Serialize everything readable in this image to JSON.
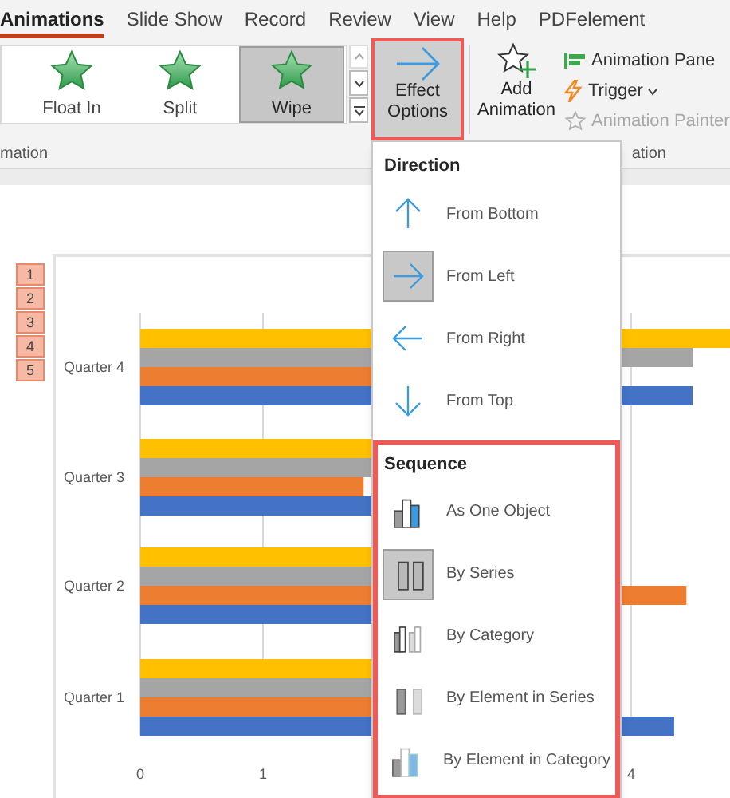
{
  "ribbon_tabs": [
    {
      "label": "Animations",
      "selected": true
    },
    {
      "label": "Slide Show",
      "selected": false
    },
    {
      "label": "Record",
      "selected": false
    },
    {
      "label": "Review",
      "selected": false
    },
    {
      "label": "View",
      "selected": false
    },
    {
      "label": "Help",
      "selected": false
    },
    {
      "label": "PDFelement",
      "selected": false
    }
  ],
  "gallery": {
    "items": [
      {
        "label": "Float In",
        "selected": false
      },
      {
        "label": "Split",
        "selected": false
      },
      {
        "label": "Wipe",
        "selected": true
      }
    ]
  },
  "effect_options": {
    "label": "Effect Options",
    "highlighted": true
  },
  "add_animation": {
    "label": "Add Animation"
  },
  "advanced": [
    {
      "kind": "pane",
      "label": "Animation Pane",
      "disabled": false,
      "dropdown": false
    },
    {
      "kind": "trigger",
      "label": "Trigger",
      "disabled": false,
      "dropdown": true
    },
    {
      "kind": "painter",
      "label": "Animation Painter",
      "disabled": true,
      "dropdown": false
    }
  ],
  "group_labels": [
    "mation",
    "ation"
  ],
  "slide": {
    "animation_tags": [
      "1",
      "2",
      "3",
      "4",
      "5"
    ],
    "chart": {
      "category_labels": [
        "Quarter 4",
        "Quarter 3",
        "Quarter 2",
        "Quarter 1"
      ],
      "axis_labels": [
        "0",
        "1",
        "4"
      ]
    }
  },
  "menu": {
    "sections": [
      {
        "title": "Direction",
        "highlighted": false,
        "items": [
          {
            "kind": "up",
            "label": "From Bottom",
            "selected": false
          },
          {
            "kind": "right",
            "label": "From Left",
            "selected": true
          },
          {
            "kind": "left",
            "label": "From Right",
            "selected": false
          },
          {
            "kind": "down",
            "label": "From Top",
            "selected": false
          }
        ]
      },
      {
        "title": "Sequence",
        "highlighted": true,
        "items": [
          {
            "kind": "one-object",
            "label": "As One Object",
            "selected": false
          },
          {
            "kind": "by-series",
            "label": "By Series",
            "selected": true
          },
          {
            "kind": "by-category",
            "label": "By Category",
            "selected": false
          },
          {
            "kind": "element-series",
            "label": "By Element in Series",
            "selected": false
          },
          {
            "kind": "element-category",
            "label": "By Element in Category",
            "selected": false
          }
        ]
      }
    ]
  }
}
